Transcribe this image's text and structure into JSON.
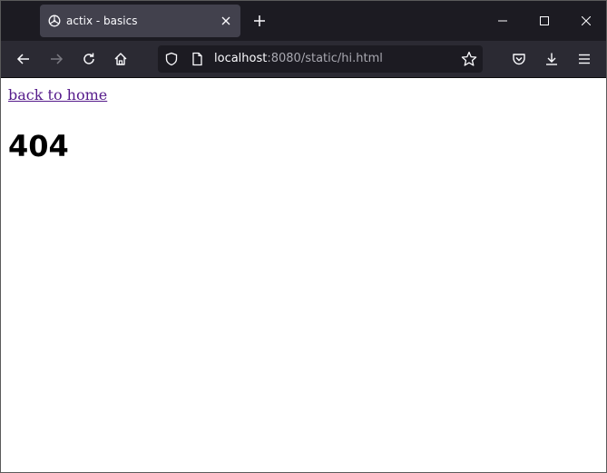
{
  "window": {
    "tab": {
      "title": "actix - basics",
      "favicon": "globe-icon"
    },
    "controls": {
      "new_tab": "plus-icon",
      "minimize": "minimize-icon",
      "maximize": "maximize-icon",
      "close": "close-icon"
    }
  },
  "toolbar": {
    "buttons": [
      "back-arrow-icon",
      "forward-arrow-icon",
      "reload-icon",
      "home-icon",
      "pocket-icon",
      "download-icon",
      "hamburger-menu-icon"
    ],
    "url": {
      "host": "localhost",
      "rest": ":8080/static/hi.html"
    },
    "icons": {
      "security": "shield-icon",
      "page": "page-icon",
      "bookmark": "star-icon"
    }
  },
  "page": {
    "link_text": "back to home",
    "heading": "404"
  },
  "colors": {
    "tabstrip_bg": "#1c1b22",
    "toolbar_bg": "#2b2a33",
    "active_tab_bg": "#42414d",
    "visited_link": "#551a8b"
  }
}
